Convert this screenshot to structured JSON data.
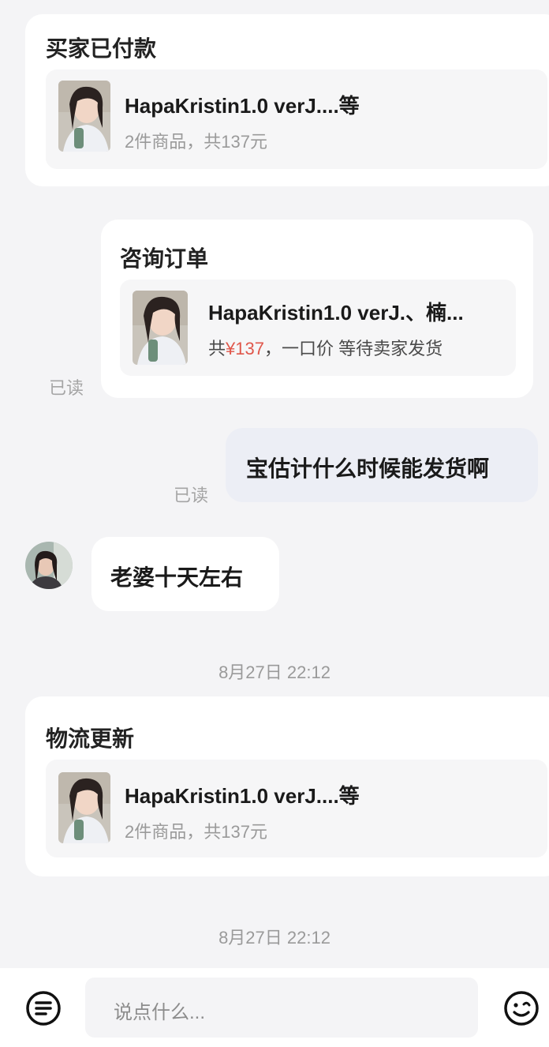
{
  "card_paid": {
    "title": "买家已付款",
    "product_name": "HapaKristin1.0 verJ....等",
    "product_sub": "2件商品，共137元"
  },
  "consult_card": {
    "title": "咨询订单",
    "product_name": "HapaKristin1.0 verJ.、楠...",
    "price_prefix": "共",
    "price": "¥137",
    "price_suffix": "，一口价 等待卖家发货",
    "read": "已读"
  },
  "message_me": {
    "text": "宝估计什么时候能发货啊",
    "read": "已读"
  },
  "message_them": {
    "text": "老婆十天左右"
  },
  "timestamp_1": "8月27日 22:12",
  "card_logistics": {
    "title": "物流更新",
    "product_name": "HapaKristin1.0 verJ....等",
    "product_sub": "2件商品，共137元"
  },
  "timestamp_2": "8月27日 22:12",
  "input_bar": {
    "placeholder": "说点什么..."
  },
  "icons": {
    "menu": "list-menu-icon",
    "emoji": "emoji-icon"
  },
  "colors": {
    "price_accent": "#e0574b",
    "my_bubble": "#eceef5"
  }
}
